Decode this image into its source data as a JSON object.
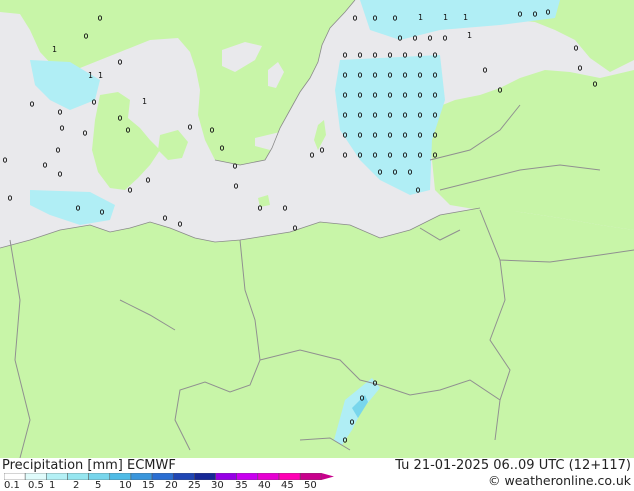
{
  "title": "Precipitation [mm]  ECMWF",
  "valid_time": "Tu 21-01-2025 06..09 UTC (12+117)",
  "credit": "© weatheronline.co.uk",
  "legend": {
    "labels": [
      "0.1",
      "0.5",
      "1",
      "2",
      "5",
      "10",
      "15",
      "20",
      "25",
      "30",
      "35",
      "40",
      "45",
      "50"
    ],
    "colors": [
      "#ffffff",
      "#e0fbfb",
      "#b4f0f5",
      "#96e6f0",
      "#78d6ec",
      "#50bce6",
      "#3a96dc",
      "#2a6ed2",
      "#1f46b4",
      "#162896",
      "#9600e6",
      "#c800f0",
      "#e600d2",
      "#ff00b4",
      "#c8008c"
    ]
  },
  "map_colors": {
    "land": "#c8f5a8",
    "sea": "#e9e9ec",
    "border": "#909090",
    "precip_light": "#b0eef5",
    "precip_medium": "#78d6ec"
  },
  "precip_labels": [
    "1",
    "1",
    "1",
    "1",
    "1",
    "1",
    "1",
    "1"
  ]
}
